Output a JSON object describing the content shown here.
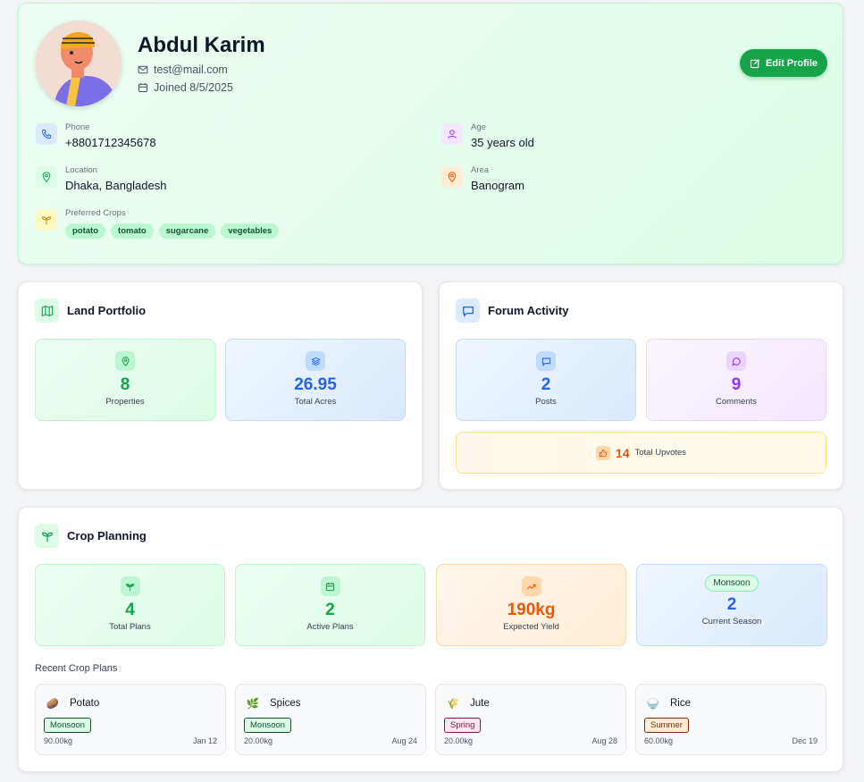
{
  "profile": {
    "name": "Abdul Karim",
    "email": "test@mail.com",
    "joined": "Joined 8/5/2025",
    "edit_label": "Edit Profile",
    "phone": {
      "label": "Phone",
      "value": "+8801712345678"
    },
    "age": {
      "label": "Age",
      "value": "35 years old"
    },
    "location": {
      "label": "Location",
      "value": "Dhaka, Bangladesh"
    },
    "area": {
      "label": "Area",
      "value": "Banogram"
    },
    "crops": {
      "label": "Preferred Crops",
      "items": [
        "potato",
        "tomato",
        "sugarcane",
        "vegetables"
      ]
    }
  },
  "land": {
    "title": "Land Portfolio",
    "properties": {
      "value": "8",
      "label": "Properties"
    },
    "acres": {
      "value": "26.95",
      "label": "Total Acres"
    }
  },
  "forum": {
    "title": "Forum Activity",
    "posts": {
      "value": "2",
      "label": "Posts"
    },
    "comments": {
      "value": "9",
      "label": "Comments"
    },
    "upvotes": {
      "value": "14",
      "label": "Total Upvotes"
    }
  },
  "crop": {
    "title": "Crop Planning",
    "total": {
      "value": "4",
      "label": "Total Plans"
    },
    "active": {
      "value": "2",
      "label": "Active Plans"
    },
    "yield": {
      "value": "190kg",
      "label": "Expected Yield"
    },
    "season": {
      "badge": "Monsoon",
      "value": "2",
      "label": "Current Season"
    },
    "recent_title": "Recent Crop Plans",
    "plans": [
      {
        "name": "Potato",
        "season": "Monsoon",
        "qty": "90.00kg",
        "date": "Jan 12",
        "emoji": "🥔"
      },
      {
        "name": "Spices",
        "season": "Monsoon",
        "qty": "20.00kg",
        "date": "Aug 24",
        "emoji": "🌿"
      },
      {
        "name": "Jute",
        "season": "Spring",
        "qty": "20.00kg",
        "date": "Aug 28",
        "emoji": "🌾"
      },
      {
        "name": "Rice",
        "season": "Summer",
        "qty": "60.00kg",
        "date": "Dec 19",
        "emoji": "🍚"
      }
    ]
  },
  "colors": {
    "primary": "#16a34a",
    "blue": "#2563eb",
    "purple": "#9333ea",
    "orange": "#ea580c"
  }
}
